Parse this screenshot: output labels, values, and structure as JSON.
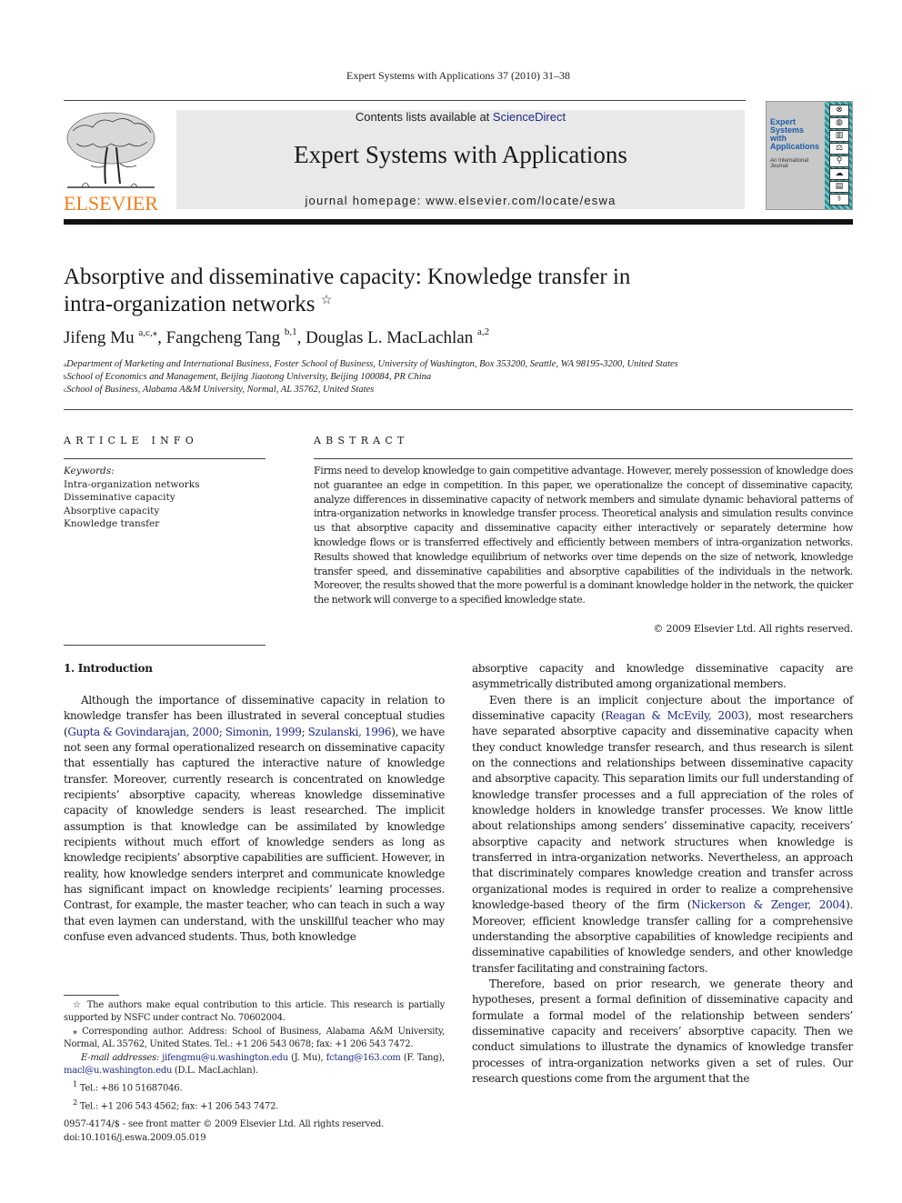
{
  "running_head": "Expert Systems with Applications 37 (2010) 31–38",
  "publisher": {
    "name": "ELSEVIER",
    "brand_color": "#f07e1a"
  },
  "masthead": {
    "contents_prefix": "Contents lists available at ",
    "contents_link": "ScienceDirect",
    "journal_title": "Expert Systems with Applications",
    "homepage": "journal homepage: www.elsevier.com/locate/eswa",
    "link_color": "#1f2a86"
  },
  "cover": {
    "title_lines": [
      "Expert",
      "Systems",
      "with",
      "Applications"
    ],
    "subtitle_lines": [
      "An International",
      "Journal"
    ],
    "icons": [
      "steering-wheel-icon",
      "globe-icon",
      "bar-chart-icon",
      "scales-icon",
      "microscope-icon",
      "cloud-icon",
      "robot-icon",
      "caduceus-icon"
    ]
  },
  "article": {
    "title_line1": "Absorptive and disseminative capacity: Knowledge transfer in",
    "title_line2": "intra-organization networks",
    "title_mark": "☆",
    "authors": [
      {
        "name": "Jifeng Mu",
        "sup": "a,c,⁎"
      },
      {
        "name": "Fangcheng Tang",
        "sup": "b,1"
      },
      {
        "name": "Douglas L. MacLachlan",
        "sup": "a,2"
      }
    ],
    "affiliations": [
      {
        "mark": "a",
        "text": "Department of Marketing and International Business, Foster School of Business, University of Washington, Box 353200, Seattle, WA 98195-3200, United States"
      },
      {
        "mark": "b",
        "text": "School of Economics and Management, Beijing Jiaotong University, Beijing 100084, PR China"
      },
      {
        "mark": "c",
        "text": "School of Business, Alabama A&M University, Normal, AL 35762, United States"
      }
    ]
  },
  "article_info": {
    "heading": "ARTICLE INFO",
    "keywords_label": "Keywords:",
    "keywords": [
      "Intra-organization networks",
      "Disseminative capacity",
      "Absorptive capacity",
      "Knowledge transfer"
    ]
  },
  "abstract": {
    "heading": "ABSTRACT",
    "text": "Firms need to develop knowledge to gain competitive advantage. However, merely possession of knowledge does not guarantee an edge in competition. In this paper, we operationalize the concept of disseminative capacity, analyze differences in disseminative capacity of network members and simulate dynamic behavioral patterns of intra-organization networks in knowledge transfer process. Theoretical analysis and simulation results convince us that absorptive capacity and disseminative capacity either interactively or separately determine how knowledge flows or is transferred effectively and efficiently between members of intra-organization networks. Results showed that knowledge equilibrium of networks over time depends on the size of network, knowledge transfer speed, and disseminative capabilities and absorptive capabilities of the individuals in the network. Moreover, the results showed that the more powerful is a dominant knowledge holder in the network, the quicker the network will converge to a specified knowledge state.",
    "copyright": "© 2009 Elsevier Ltd. All rights reserved."
  },
  "introduction": {
    "heading": "1. Introduction",
    "p1": {
      "before": "Although the importance of disseminative capacity in relation to knowledge transfer has been illustrated in several conceptual studies (",
      "citations": [
        "Gupta & Govindarajan, 2000",
        "Simonin, 1999",
        "Szulanski, 1996"
      ],
      "after": "), we have not seen any formal operationalized research on disseminative capacity that essentially has captured the interactive nature of knowledge transfer. Moreover, currently research is concentrated on knowledge recipients’ absorptive capacity, whereas knowledge disseminative capacity of knowledge senders is least researched. The implicit assumption is that knowledge can be assimilated by knowledge recipients without much effort of knowledge senders as long as knowledge recipients’ absorptive capabilities are sufficient. However, in reality, how knowledge senders interpret and communicate knowledge has significant impact on knowledge recipients’ learning processes. Contrast, for example, the master teacher, who can teach in such a way that even laymen can understand, with the unskillful teacher who may confuse even advanced students. Thus, both knowledge"
    },
    "p1_cont": "absorptive capacity and knowledge disseminative capacity are asymmetrically distributed among organizational members.",
    "p2": {
      "before": "Even there is an implicit conjecture about the importance of disseminative capacity (",
      "citation1": "Reagan & McEvily, 2003",
      "middle": "), most researchers have separated absorptive capacity and disseminative capacity when they conduct knowledge transfer research, and thus research is silent on the connections and relationships between disseminative capacity and absorptive capacity. This separation limits our full understanding of knowledge transfer processes and a full appreciation of the roles of knowledge holders in knowledge transfer processes. We know little about relationships among senders’ disseminative capacity, receivers’ absorptive capacity and network structures when knowledge is transferred in intra-organization networks. Nevertheless, an approach that discriminately compares knowledge creation and transfer across organizational modes is required in order to realize a comprehensive knowledge-based theory of the firm (",
      "citation2": "Nickerson & Zenger, 2004",
      "after": "). Moreover, efficient knowledge transfer calling for a comprehensive understanding the absorptive capabilities of knowledge recipients and disseminative capabilities of knowledge senders, and other knowledge transfer facilitating and constraining factors."
    },
    "p3": "Therefore, based on prior research, we generate theory and hypotheses, present a formal definition of disseminative capacity and formulate a formal model of the relationship between senders’ disseminative capacity and receivers’ absorptive capacity. Then we conduct simulations to illustrate the dynamics of knowledge transfer processes of intra-organization networks given a set of rules. Our research questions come from the argument that the"
  },
  "footnotes": {
    "star": {
      "mark": "☆",
      "text": "The authors make equal contribution to this article. This research is partially supported by NSFC under contract No. 70602004."
    },
    "corresponding": {
      "mark": "⁎",
      "text": "Corresponding author. Address: School of Business, Alabama A&M University, Normal, AL 35762, United States. Tel.: +1 206 543 0678; fax: +1 206 543 7472."
    },
    "email": {
      "label": "E-mail addresses:",
      "entries": [
        {
          "email": "jifengmu@u.washington.edu",
          "who": "(J. Mu),"
        },
        {
          "email": "fctang@163.com",
          "who": "(F. Tang),"
        },
        {
          "email": "macl@u.washington.edu",
          "who": "(D.L. MacLachlan)."
        }
      ]
    },
    "fn1": {
      "mark": "1",
      "text": "Tel.: +86 10 51687046."
    },
    "fn2": {
      "mark": "2",
      "text": "Tel.: +1 206 543 4562; fax: +1 206 543 7472."
    }
  },
  "front_matter": {
    "issn_line": "0957-4174/$ - see front matter © 2009 Elsevier Ltd. All rights reserved.",
    "doi": "doi:10.1016/j.eswa.2009.05.019"
  }
}
